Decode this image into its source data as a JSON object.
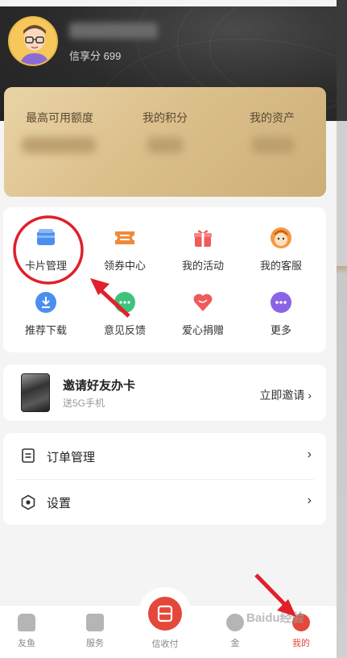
{
  "header": {
    "credit_score": "信享分 699"
  },
  "assets": {
    "columns": [
      {
        "label": "最高可用额度"
      },
      {
        "label": "我的积分"
      },
      {
        "label": "我的资产"
      }
    ]
  },
  "services": [
    {
      "label": "卡片管理",
      "icon": "card-icon",
      "color": "#4a8ff0"
    },
    {
      "label": "领券中心",
      "icon": "ticket-icon",
      "color": "#f08a3a"
    },
    {
      "label": "我的活动",
      "icon": "gift-icon",
      "color": "#ef5a5a"
    },
    {
      "label": "我的客服",
      "icon": "service-icon",
      "color": "#f7973f"
    },
    {
      "label": "推荐下载",
      "icon": "download-icon",
      "color": "#4a8ff0"
    },
    {
      "label": "意见反馈",
      "icon": "chat-icon",
      "color": "#3ec47a"
    },
    {
      "label": "爱心捐赠",
      "icon": "heart-icon",
      "color": "#ef5a5a"
    },
    {
      "label": "更多",
      "icon": "more-icon",
      "color": "#8a63e6"
    }
  ],
  "invite": {
    "title": "邀请好友办卡",
    "subtitle": "送5G手机",
    "link": "立即邀请"
  },
  "menu": [
    {
      "label": "订单管理",
      "icon": "order-icon"
    },
    {
      "label": "设置",
      "icon": "settings-icon"
    }
  ],
  "tabbar": {
    "items": [
      {
        "label": "友鱼"
      },
      {
        "label": "服务"
      },
      {
        "label": "信收付"
      },
      {
        "label": "金"
      },
      {
        "label": "我的"
      }
    ]
  },
  "colors": {
    "accent": "#e4483a",
    "annotation": "#e0202a"
  },
  "watermark": "Baidu经验"
}
